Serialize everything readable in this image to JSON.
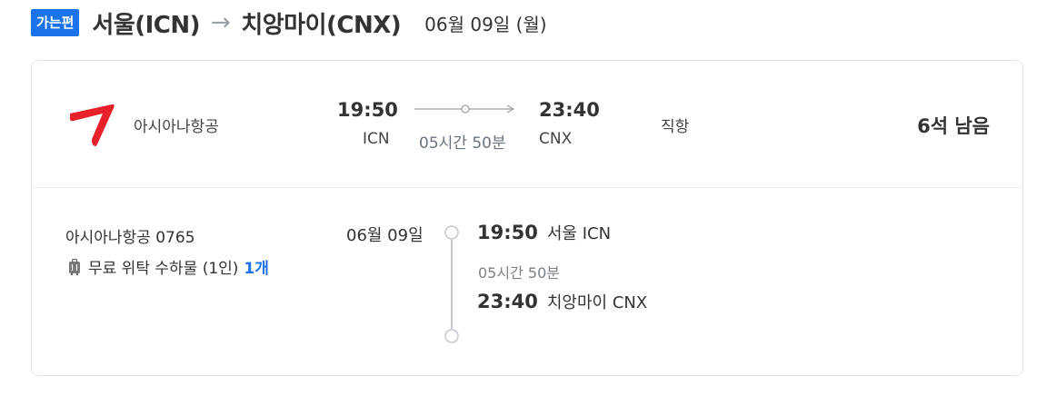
{
  "header": {
    "badge": "가는편",
    "origin": "서울(ICN)",
    "arrow": "→",
    "destination": "치앙마이(CNX)",
    "date": "06월 09일 (월)"
  },
  "summary": {
    "airline_logo": "asiana-logo",
    "airline": "아시아나항공",
    "departure_time": "19:50",
    "departure_code": "ICN",
    "duration": "05시간 50분",
    "arrival_time": "23:40",
    "arrival_code": "CNX",
    "stops": "직항",
    "seats_left": "6석 남음"
  },
  "detail": {
    "flight_number": "아시아나항공 0765",
    "baggage_label": "무료 위탁 수하물 (1인)",
    "baggage_count": "1개",
    "date": "06월 09일",
    "departure_time": "19:50",
    "departure_place": "서울 ICN",
    "duration": "05시간 50분",
    "arrival_time": "23:40",
    "arrival_place": "치앙마이 CNX"
  },
  "colors": {
    "accent": "#1a73e8",
    "brand_red": "#e8202a",
    "border": "#e3e5e8"
  }
}
